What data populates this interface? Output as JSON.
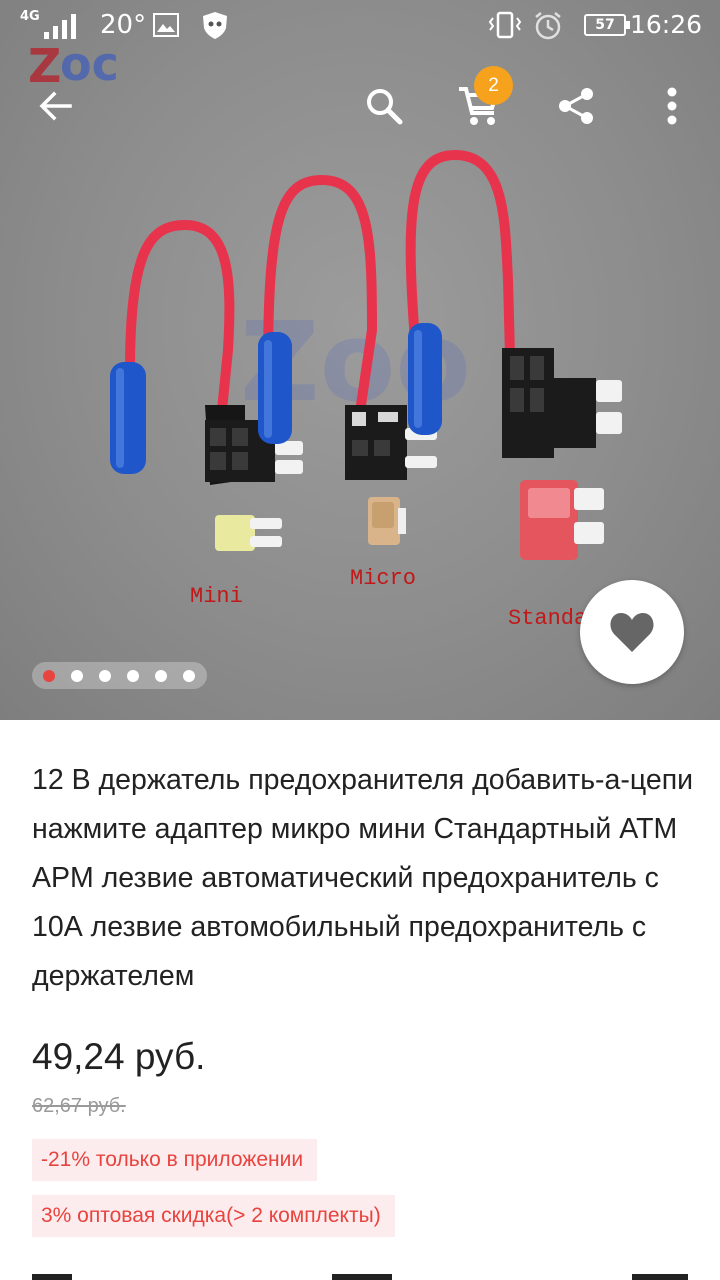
{
  "status_bar": {
    "network": "4G",
    "temperature": "20°",
    "battery": "57",
    "time": "16:26"
  },
  "toolbar": {
    "cart_count": "2",
    "icons": [
      "back-arrow-icon",
      "search-icon",
      "cart-icon",
      "share-icon",
      "more-vert-icon"
    ]
  },
  "gallery": {
    "image_labels": {
      "mini": "Mini",
      "micro": "Micro",
      "standard": "Standa"
    },
    "dot_count": 6,
    "active_index": 0
  },
  "product": {
    "title": "12 В держатель предохранителя добавить-а-цепи нажмите адаптер микро мини Стандартный ATM APM лезвие автоматический предохранитель с 10А лезвие автомобильный предохранитель с держателем",
    "price": "49,24 руб.",
    "old_price": "62,67 руб.",
    "promos": [
      "-21% только в приложении",
      "3% оптовая скидка(> 2 комплекты)"
    ]
  },
  "colors": {
    "accent": "#e8433e",
    "badge": "#f7a21d",
    "promo_bg": "#fdeced"
  }
}
